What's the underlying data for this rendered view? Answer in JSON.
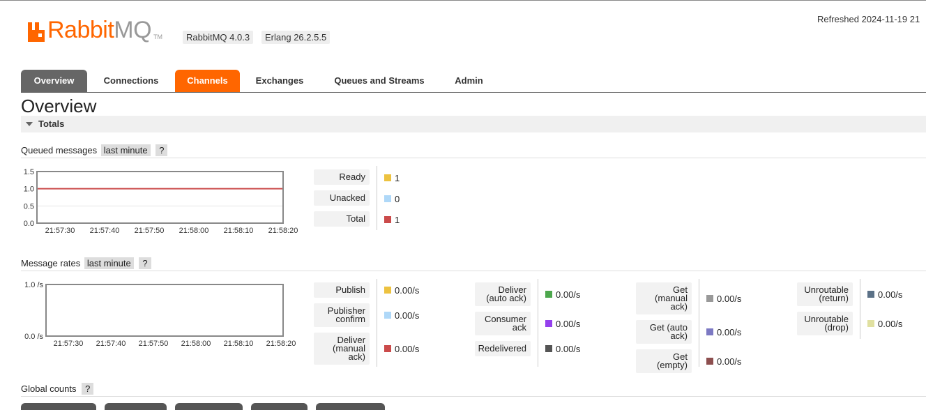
{
  "header": {
    "logo_rabbit": "Rabbit",
    "logo_mq": "MQ",
    "logo_tm": "TM",
    "rabbitmq_version": "RabbitMQ 4.0.3",
    "erlang_version": "Erlang 26.2.5.5",
    "refreshed": "Refreshed 2024-11-19 21"
  },
  "tabs": [
    {
      "label": "Overview",
      "state": "active"
    },
    {
      "label": "Connections",
      "state": "normal"
    },
    {
      "label": "Channels",
      "state": "highlight"
    },
    {
      "label": "Exchanges",
      "state": "normal"
    },
    {
      "label": "Queues and Streams",
      "state": "normal"
    },
    {
      "label": "Admin",
      "state": "normal"
    }
  ],
  "page_title": "Overview",
  "totals_section": {
    "label": "Totals"
  },
  "queued_messages": {
    "title": "Queued messages",
    "range": "last minute",
    "help": "?",
    "legend": [
      {
        "label": "Ready",
        "value": "1",
        "color": "#edc240"
      },
      {
        "label": "Unacked",
        "value": "0",
        "color": "#afd8f8"
      },
      {
        "label": "Total",
        "value": "1",
        "color": "#cb4b4b"
      }
    ]
  },
  "message_rates": {
    "title": "Message rates",
    "range": "last minute",
    "help": "?",
    "legend_columns": [
      [
        {
          "label": "Publish",
          "value": "0.00/s",
          "color": "#edc240"
        },
        {
          "label": "Publisher confirm",
          "value": "0.00/s",
          "color": "#afd8f8"
        },
        {
          "label": "Deliver (manual ack)",
          "value": "0.00/s",
          "color": "#cb4b4b"
        }
      ],
      [
        {
          "label": "Deliver (auto ack)",
          "value": "0.00/s",
          "color": "#4da74d"
        },
        {
          "label": "Consumer ack",
          "value": "0.00/s",
          "color": "#9440ed"
        },
        {
          "label": "Redelivered",
          "value": "0.00/s",
          "color": "#555555"
        }
      ],
      [
        {
          "label": "Get (manual ack)",
          "value": "0.00/s",
          "color": "#999999"
        },
        {
          "label": "Get (auto ack)",
          "value": "0.00/s",
          "color": "#7c79c3"
        },
        {
          "label": "Get (empty)",
          "value": "0.00/s",
          "color": "#8d4f4f"
        }
      ],
      [
        {
          "label": "Unroutable (return)",
          "value": "0.00/s",
          "color": "#5b7187"
        },
        {
          "label": "Unroutable (drop)",
          "value": "0.00/s",
          "color": "#e0e0a0"
        }
      ]
    ]
  },
  "global_counts": {
    "title": "Global counts",
    "help": "?"
  },
  "chart_data": [
    {
      "type": "line",
      "title": "Queued messages",
      "x": [
        "21:57:30",
        "21:57:40",
        "21:57:50",
        "21:58:00",
        "21:58:10",
        "21:58:20"
      ],
      "yticks": [
        "0.0",
        "0.5",
        "1.0",
        "1.5"
      ],
      "ylim": [
        0,
        1.5
      ],
      "grid": true,
      "series": [
        {
          "name": "Ready",
          "color": "#edc240",
          "values": [
            1,
            1,
            1,
            1,
            1,
            1
          ]
        },
        {
          "name": "Unacked",
          "color": "#afd8f8",
          "values": [
            0,
            0,
            0,
            0,
            0,
            0
          ]
        },
        {
          "name": "Total",
          "color": "#cb4b4b",
          "values": [
            1,
            1,
            1,
            1,
            1,
            1
          ]
        }
      ]
    },
    {
      "type": "line",
      "title": "Message rates",
      "x": [
        "21:57:30",
        "21:57:40",
        "21:57:50",
        "21:58:00",
        "21:58:10",
        "21:58:20"
      ],
      "yticks": [
        "0.0 /s",
        "1.0 /s"
      ],
      "ylim": [
        0,
        1.0
      ],
      "grid": false,
      "series": [
        {
          "name": "Publish",
          "color": "#edc240",
          "values": [
            0,
            0,
            0,
            0,
            0,
            0
          ]
        },
        {
          "name": "Publisher confirm",
          "color": "#afd8f8",
          "values": [
            0,
            0,
            0,
            0,
            0,
            0
          ]
        }
      ]
    }
  ]
}
